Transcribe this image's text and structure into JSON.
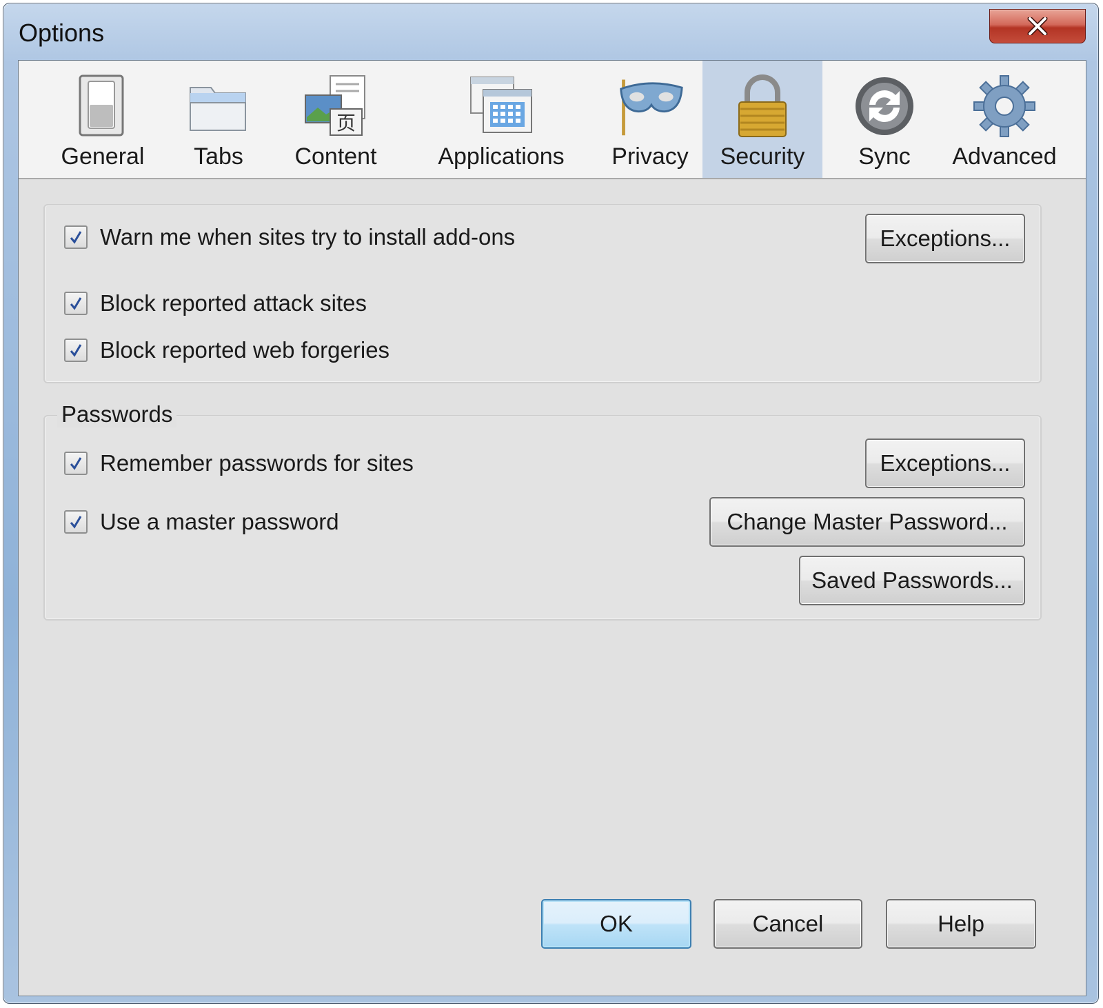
{
  "window": {
    "title": "Options",
    "close_icon": "close-icon"
  },
  "toolbar": {
    "tabs": [
      {
        "label": "General",
        "icon": "general-switch-icon"
      },
      {
        "label": "Tabs",
        "icon": "tabs-folder-icon"
      },
      {
        "label": "Content",
        "icon": "content-page-icon"
      },
      {
        "label": "Applications",
        "icon": "applications-window-icon"
      },
      {
        "label": "Privacy",
        "icon": "privacy-mask-icon"
      },
      {
        "label": "Security",
        "icon": "security-padlock-icon",
        "selected": true
      },
      {
        "label": "Sync",
        "icon": "sync-arrows-icon"
      },
      {
        "label": "Advanced",
        "icon": "advanced-gear-icon"
      }
    ],
    "selected_color": "#c4d3e6"
  },
  "general_group": {
    "warn_addons": {
      "label": "Warn me when sites try to install add-ons",
      "checked": true
    },
    "exceptions_button": "Exceptions...",
    "block_attack": {
      "label": "Block reported attack sites",
      "checked": true
    },
    "block_forgeries": {
      "label": "Block reported web forgeries",
      "checked": true
    }
  },
  "passwords_group": {
    "caption": "Passwords",
    "remember": {
      "label": "Remember passwords for sites",
      "checked": true
    },
    "exceptions_button": "Exceptions...",
    "master": {
      "label": "Use a master password",
      "checked": true
    },
    "change_master_button": "Change Master Password...",
    "saved_passwords_button": "Saved Passwords..."
  },
  "footer": {
    "ok": "OK",
    "cancel": "Cancel",
    "help": "Help",
    "default_button_color": "#3c7fb1"
  }
}
